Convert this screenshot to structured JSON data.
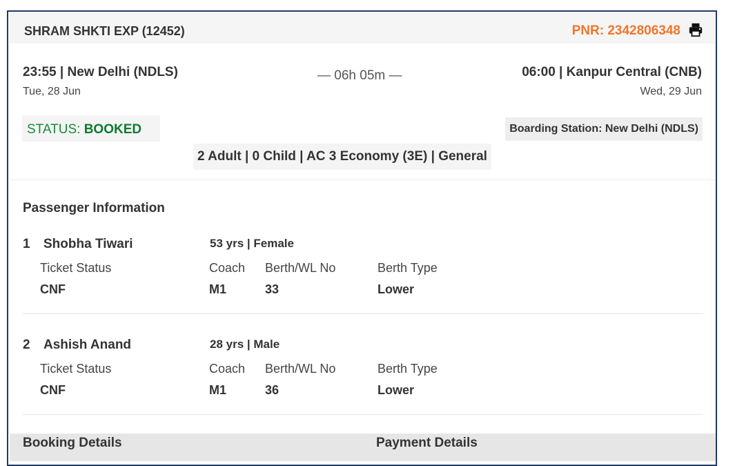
{
  "train": {
    "name": "SHRAM SHKTI EXP (12452)",
    "pnr": "PNR: 2342806348",
    "print_icon": "printer-icon"
  },
  "journey": {
    "depart": "23:55 | New Delhi (NDLS)",
    "depart_date": "Tue, 28 Jun",
    "duration": "— 06h 05m —",
    "arrive": "06:00 | Kanpur Central (CNB)",
    "arrive_date": "Wed, 29 Jun"
  },
  "status": {
    "label": "STATUS: ",
    "value": "BOOKED"
  },
  "boarding": "Boarding Station: New Delhi (NDLS)",
  "pax_summary": "2 Adult | 0 Child | AC 3 Economy (3E) | General",
  "passengers": {
    "title": "Passenger Information",
    "headers": {
      "ticket_status": "Ticket Status",
      "coach": "Coach",
      "berth": "Berth/WL No",
      "berth_type": "Berth Type"
    },
    "list": [
      {
        "num": "1",
        "name": "Shobha Tiwari",
        "age_gender": "53 yrs | Female",
        "ticket_status": "CNF",
        "coach": "M1",
        "berth": "33",
        "berth_type": "Lower"
      },
      {
        "num": "2",
        "name": "Ashish Anand",
        "age_gender": "28 yrs | Male",
        "ticket_status": "CNF",
        "coach": "M1",
        "berth": "36",
        "berth_type": "Lower"
      }
    ]
  },
  "footer": {
    "booking": "Booking Details",
    "payment": "Payment Details"
  },
  "colors": {
    "border": "#1f3a66",
    "pnr": "#f2752a",
    "status": "#0d7a2f"
  }
}
